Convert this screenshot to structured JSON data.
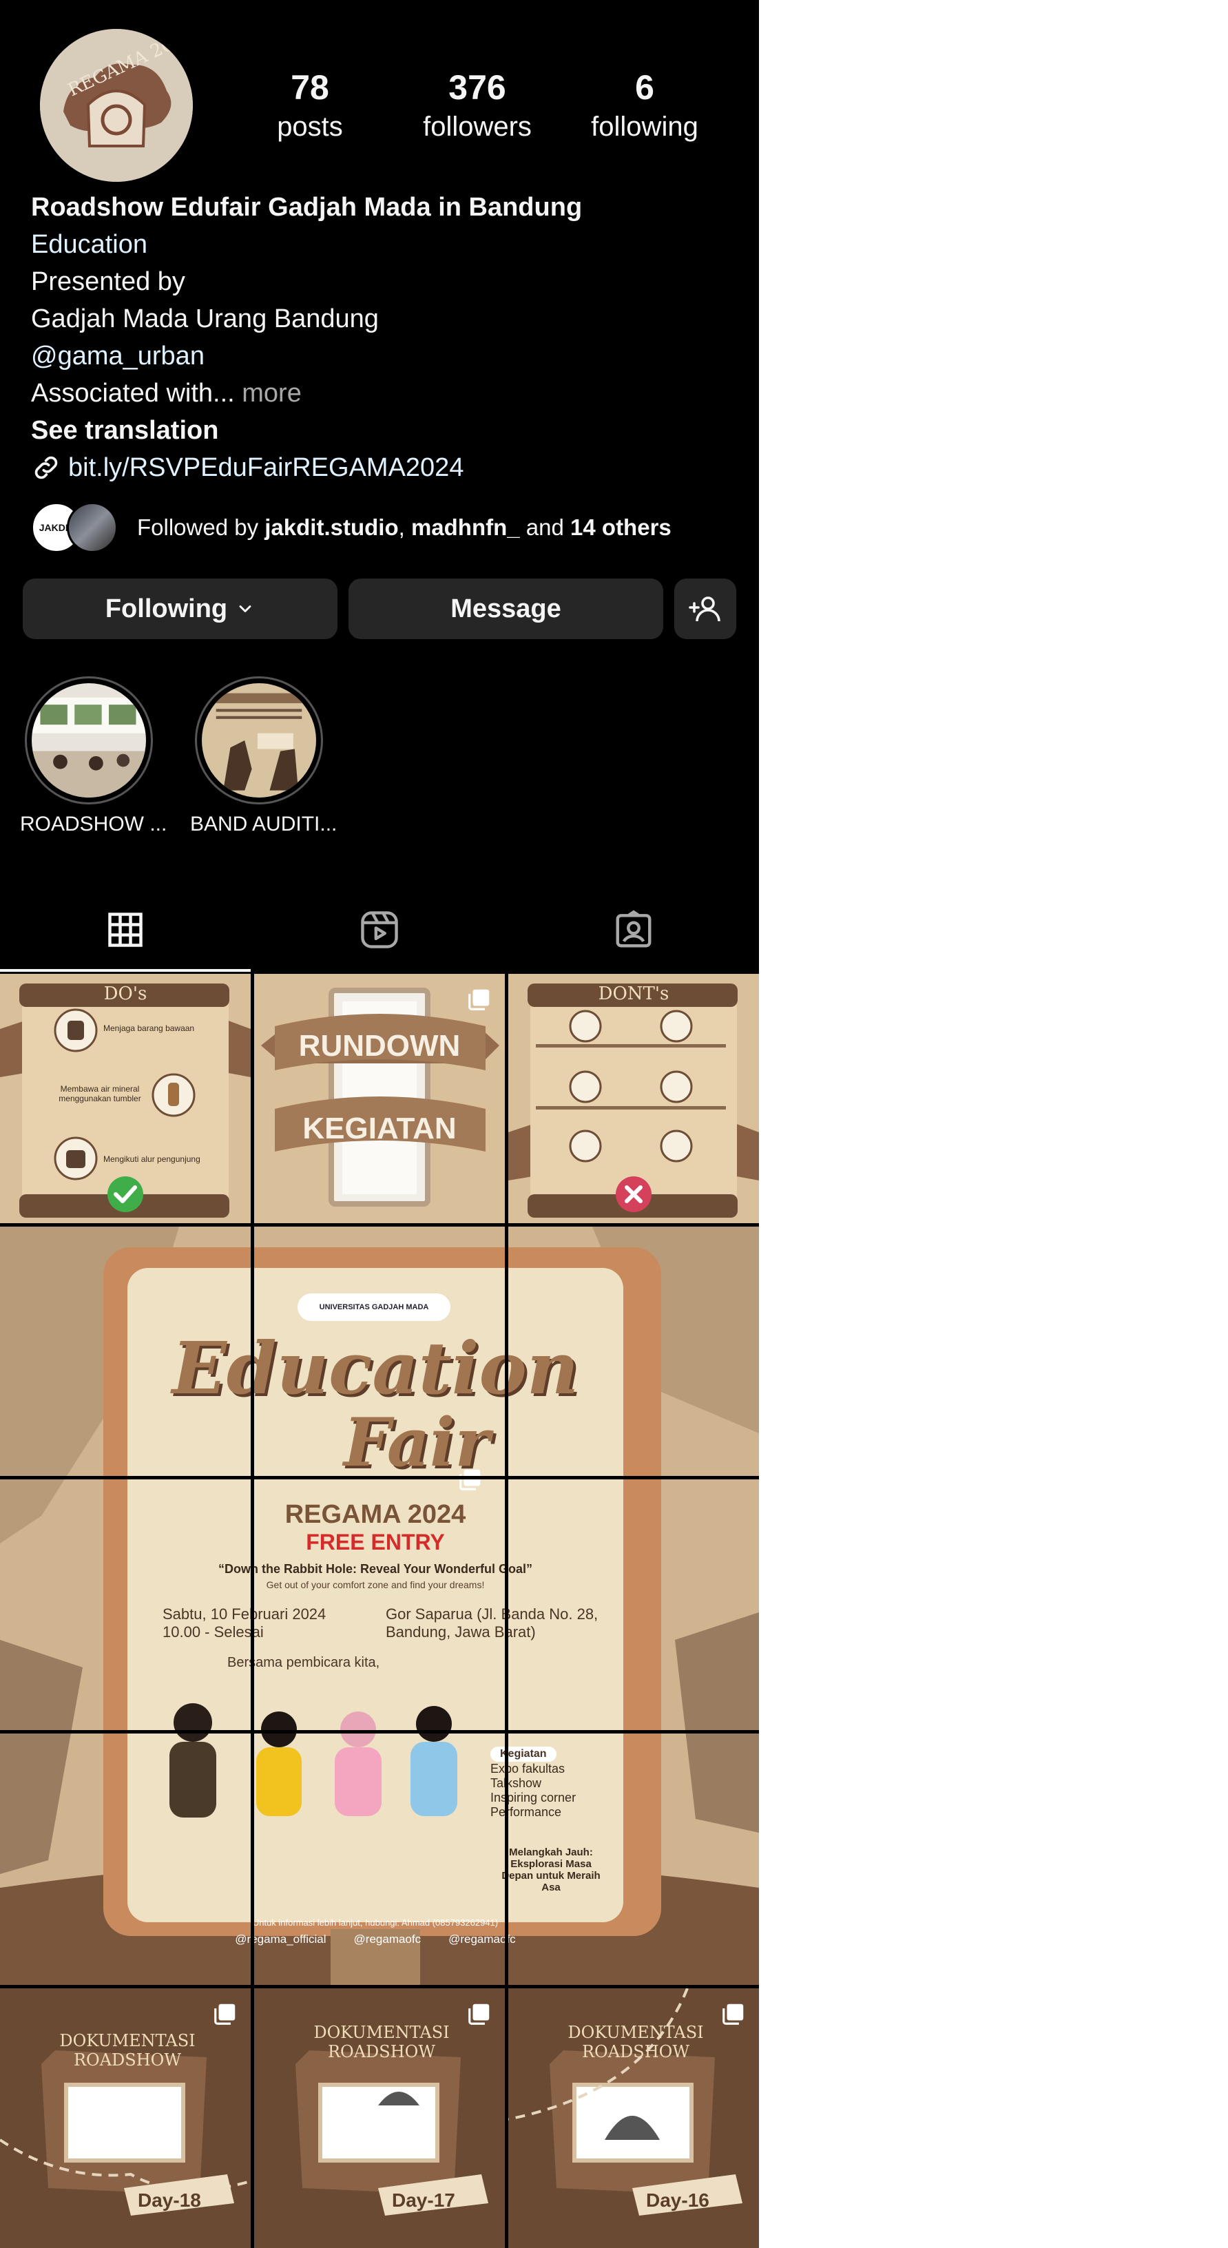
{
  "profile": {
    "stats": [
      {
        "value": "78",
        "label": "posts"
      },
      {
        "value": "376",
        "label": "followers"
      },
      {
        "value": "6",
        "label": "following"
      }
    ],
    "avatar_text": "REGAMA 2024",
    "bio": {
      "name": "Roadshow Edufair Gadjah Mada in Bandung",
      "category": "Education",
      "line1": "Presented by",
      "line2": "Gadjah Mada Urang Bandung",
      "mention": "@gama_urban",
      "assoc": "Associated with...",
      "more": " more",
      "translation": "See translation",
      "link": "bit.ly/RSVPEduFairREGAMA2024"
    },
    "followed_by": {
      "prefix": "Followed by ",
      "user1": "jakdit.studio",
      "sep": ", ",
      "user2": "madhnfn_",
      "and": " and ",
      "others": "14 others",
      "avatar1_text": "JAKDIT"
    }
  },
  "actions": {
    "following": "Following",
    "message": "Message"
  },
  "highlights": [
    {
      "label": "ROADSHOW ..."
    },
    {
      "label": "BAND AUDITI..."
    }
  ],
  "tabs": [
    "posts-grid-icon",
    "reels-icon",
    "tagged-icon"
  ],
  "posts": {
    "dos_title": "DO's",
    "dos_items": [
      "Menjaga barang bawaan",
      "Membawa air mineral menggunakan tumbler",
      "Mengikuti alur pengunjung"
    ],
    "donts_title": "DONT's",
    "rundown_1": "RUNDOWN",
    "rundown_2": "KEGIATAN",
    "poster": {
      "univ": "UNIVERSITAS GADJAH MADA",
      "title_1": "Education",
      "title_2": "Fair",
      "event": "REGAMA 2024",
      "entry": "FREE ENTRY",
      "theme": "“Down the Rabbit Hole: Reveal Your Wonderful Goal”",
      "tagline": "Get out of your comfort zone and find your dreams!",
      "date": "Sabtu, 10 Februari 2024",
      "time": "10.00 - Selesai",
      "venue": "Gor Saparua (Jl. Banda No. 28, Bandung, Jawa Barat)",
      "speakers_intro": "Bersama pembicara kita,",
      "kegiatan": "Kegiatan",
      "activities": [
        "Expo fakultas",
        "Talkshow",
        "Inspiring corner",
        "Performance"
      ],
      "slogan": "Melangkah Jauh: Eksplorasi Masa Depan untuk Meraih Asa",
      "contact": "Untuk informasi lebih lanjut, hubungi: Ahmad (085793262941)",
      "social_1": "@regama_official",
      "social_2": "@regamaofc",
      "social_3": "@regamaofc"
    },
    "doc_title": "DOKUMENTASI ROADSHOW",
    "doc_days": [
      "Day-18",
      "Day-17",
      "Day-16"
    ]
  },
  "colors": {
    "background": "#000000",
    "button": "#262626",
    "link": "#e0f1ff",
    "tan": "#d6bd96",
    "brown": "#6e4d36"
  }
}
